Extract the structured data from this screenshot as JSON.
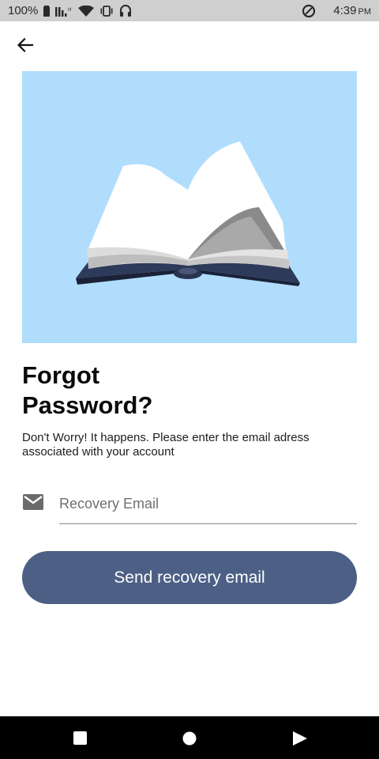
{
  "status_bar": {
    "battery_text": "100%",
    "time": "4:39",
    "ampm": "PM",
    "icons": [
      "battery-icon",
      "signal-icon",
      "wifi-icon",
      "vibrate-icon",
      "headphones-icon",
      "data-saver-icon"
    ]
  },
  "app_bar": {
    "back_icon": "arrow-back-icon"
  },
  "hero": {
    "image": "open-book-illustration",
    "background_color": "#b1ddfd"
  },
  "title": {
    "line1": "Forgot",
    "line2": "Password?"
  },
  "subtitle": {
    "line1": "Don't Worry! It happens. Please enter the email adress",
    "line2": "associated with your account"
  },
  "email_field": {
    "icon": "mail-icon",
    "placeholder": "Recovery Email",
    "value": ""
  },
  "send_button": {
    "label": "Send recovery email",
    "color": "#4c6085"
  },
  "nav_bar": {
    "icons": [
      "recents-square-icon",
      "home-circle-icon",
      "back-triangle-icon"
    ]
  }
}
